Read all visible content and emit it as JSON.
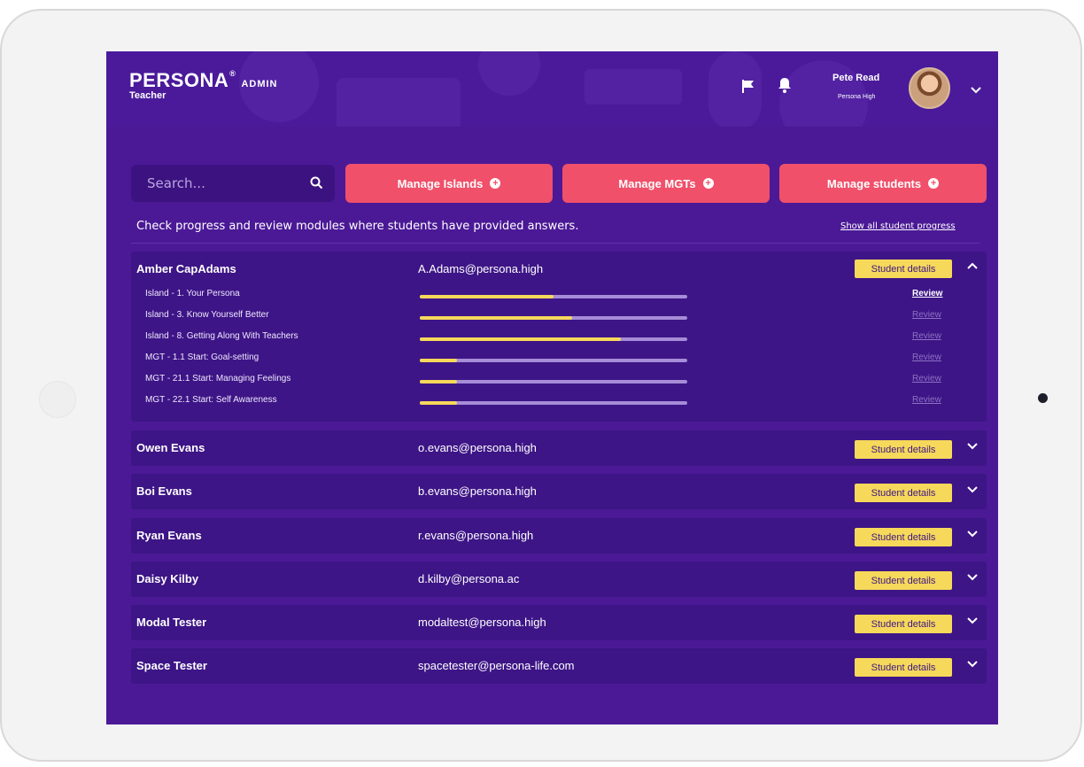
{
  "header": {
    "brand": "PERSONA",
    "brand_mark": "®",
    "brand_suffix": "ADMIN",
    "role": "Teacher",
    "user_name": "Pete Read",
    "user_school": "Persona High"
  },
  "search": {
    "placeholder": "Search..."
  },
  "actions": [
    {
      "label": "Manage Islands"
    },
    {
      "label": "Manage MGTs"
    },
    {
      "label": "Manage students"
    }
  ],
  "intro_text": "Check progress and review modules where students have provided answers.",
  "show_all_label": "Show all student progress",
  "student_details_label": "Student details",
  "review_label": "Review",
  "students": [
    {
      "name": "Amber CapAdams",
      "email": "A.Adams@persona.high",
      "expanded": true,
      "modules": [
        {
          "label": "Island - 1. Your Persona",
          "progress": 0.5,
          "review_active": true
        },
        {
          "label": "Island - 3. Know Yourself Better",
          "progress": 0.57,
          "review_active": false
        },
        {
          "label": "Island - 8. Getting Along With Teachers",
          "progress": 0.75,
          "review_active": false
        },
        {
          "label": "MGT - 1.1 Start: Goal-setting",
          "progress": 0.14,
          "review_active": false
        },
        {
          "label": "MGT - 21.1 Start: Managing Feelings",
          "progress": 0.14,
          "review_active": false
        },
        {
          "label": "MGT - 22.1 Start: Self Awareness",
          "progress": 0.14,
          "review_active": false
        }
      ]
    },
    {
      "name": "Owen Evans",
      "email": "o.evans@persona.high",
      "expanded": false
    },
    {
      "name": "Boi Evans",
      "email": "b.evans@persona.high",
      "expanded": false
    },
    {
      "name": "Ryan Evans",
      "email": "r.evans@persona.high",
      "expanded": false
    },
    {
      "name": "Daisy Kilby",
      "email": "d.kilby@persona.ac",
      "expanded": false
    },
    {
      "name": "Modal Tester",
      "email": "modaltest@persona.high",
      "expanded": false
    },
    {
      "name": "Space Tester",
      "email": "spacetester@persona-life.com",
      "expanded": false
    }
  ],
  "colors": {
    "background": "#4b1996",
    "row": "#3d1586",
    "accent_button": "#f0506a",
    "details_button": "#f6d85b",
    "progress_fill": "#f6d85b",
    "progress_track": "#a78cd8"
  },
  "icons": {
    "search": "search-icon",
    "flag": "flag-icon",
    "bell": "bell-icon",
    "dropdown": "chevron-down-icon",
    "collapse": "chevron-up-icon",
    "add": "plus-circle-icon"
  }
}
